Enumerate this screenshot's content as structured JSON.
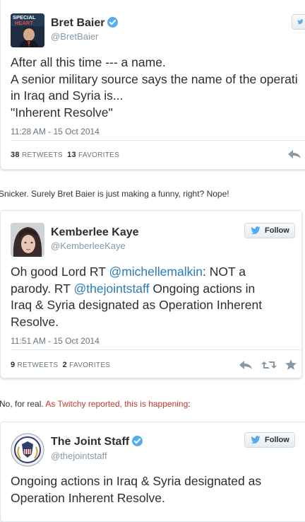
{
  "tweets": [
    {
      "name": "Bret Baier",
      "handle": "@BretBaier",
      "avatar_text_1": "SPECIAL",
      "avatar_text_2": "HEART",
      "lines": [
        "After all this time --- a name.",
        "A senior military source says the name of the operati",
        "in Iraq and Syria is...",
        "\"Inherent Resolve\""
      ],
      "date": "11:28 AM - 15 Oct 2014",
      "retweets_count": "38",
      "retweets_label": "RETWEETS",
      "favorites_count": "13",
      "favorites_label": "FAVORITES"
    },
    {
      "name": "Kemberlee Kaye",
      "handle": "@KemberleeKaye",
      "follow_label": "Follow",
      "line1_prefix": "Oh good Lord RT ",
      "line1_mention": "@michellemalkin",
      "line1_suffix": ": NOT a",
      "line2_prefix": "parody. RT ",
      "line2_mention": "@thejointstaff",
      "line2_suffix": " Ongoing actions in",
      "line3": "Iraq & Syria designated as Operation Inherent",
      "line4": "Resolve.",
      "date": "11:51 AM - 15 Oct 2014",
      "retweets_count": "9",
      "retweets_label": "RETWEETS",
      "favorites_count": "2",
      "favorites_label": "FAVORITES"
    },
    {
      "name": "The Joint Staff",
      "handle": "@thejointstaff",
      "follow_label": "Follow",
      "lines": [
        "Ongoing actions in Iraq & Syria designated as",
        "Operation Inherent Resolve."
      ]
    }
  ],
  "interstitials": {
    "first": "Snicker. Surely Bret Baier is just making a funny, right? Nope!",
    "second_prefix": "No, for real. ",
    "second_link": "As Twitchy reported, this is happening",
    "second_suffix": ":"
  },
  "colors": {
    "verified": "#55acee",
    "link": "#2b7bb9",
    "twitchy_link": "#c0392b",
    "handle": "#8899a6"
  }
}
